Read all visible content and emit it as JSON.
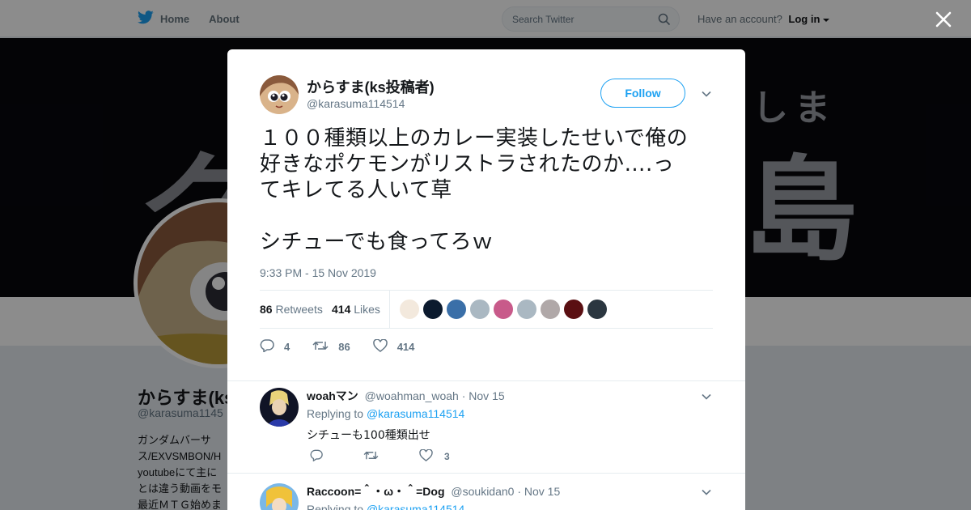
{
  "topbar": {
    "home_label": "Home",
    "about_label": "About",
    "search_placeholder": "Search Twitter",
    "have_account": "Have an account?",
    "login_label": "Log in"
  },
  "background_profile": {
    "banner_text_left": "ク",
    "banner_text_right": "島",
    "banner_text_small": "しま",
    "name": "からすま(ks",
    "handle": "@karasuma1145",
    "bio_lines": [
      "ガンダムバーサ",
      "ス/EXVSMBON/H",
      "youtubeにて主に",
      "とは違う動画をモ",
      "最近ＭＴＧ始めま"
    ]
  },
  "tweet": {
    "name": "からすま(ks投稿者)",
    "handle": "@karasuma114514",
    "follow_label": "Follow",
    "text": "１００種類以上のカレー実装したせいで俺の\n好きなポケモンがリストラされたのか….っ\nてキレてる人いて草\n\nシチューでも食ってろｗ",
    "timestamp": "9:33 PM - 15 Nov 2019",
    "retweets_count": "86",
    "retweets_label": "Retweets",
    "likes_count": "414",
    "likes_label": "Likes",
    "reply_count": "4",
    "retweet_action_count": "86",
    "like_action_count": "414",
    "liker_avatar_colors": [
      "#f3e9dd",
      "#0b1a2e",
      "#3a6fa8",
      "#aab8c2",
      "#c85a8a",
      "#aab8c2",
      "#b0a8a8",
      "#5a0f12",
      "#2b3640"
    ]
  },
  "replies": [
    {
      "name": "woahマン",
      "handle": "@woahman_woah",
      "date": "· Nov 15",
      "replying_prefix": "Replying to",
      "replying_to": "@karasuma114514",
      "text": "シチューも100種類出せ",
      "reply_count": "",
      "retweet_count": "",
      "like_count": "3"
    },
    {
      "name": "Raccoon=＾・ω・＾=Dog",
      "handle": "@soukidan0",
      "date": "· Nov 15",
      "replying_prefix": "Replying to",
      "replying_to": "@karasuma114514"
    }
  ],
  "colors": {
    "accent": "#1da1f2",
    "twitter_blue": "#1da1f2",
    "muted_text": "#657786"
  }
}
